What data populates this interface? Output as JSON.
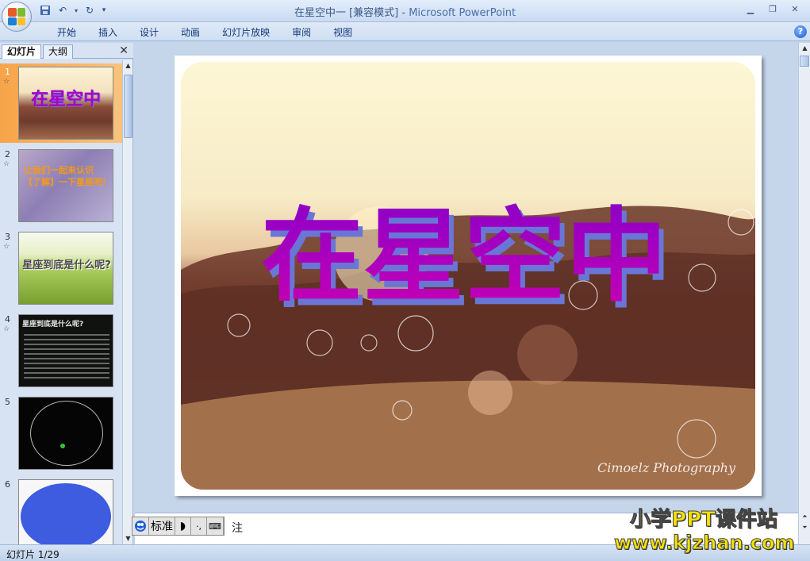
{
  "window": {
    "title": "在星空中一 [兼容模式] - Microsoft PowerPoint",
    "title_doc": "在星空中一 [兼容模式]",
    "title_sep": " - ",
    "title_app": "Microsoft PowerPoint",
    "minimize_icon": "minimize-icon",
    "restore_icon": "restore-icon",
    "close_icon": "close-icon"
  },
  "ribbon": {
    "tabs": [
      "开始",
      "插入",
      "设计",
      "动画",
      "幻灯片放映",
      "审阅",
      "视图"
    ],
    "help_label": "?"
  },
  "left_pane": {
    "tab_slides": "幻灯片",
    "tab_outline": "大纲",
    "close_label": "✕",
    "thumbnails": [
      {
        "num": "1",
        "star": "☆",
        "text": "在星空中"
      },
      {
        "num": "2",
        "star": "☆",
        "text": "让我们一起来认识【了解】一下星座吧!"
      },
      {
        "num": "3",
        "star": "☆",
        "text": "星座到底是什么呢?"
      },
      {
        "num": "4",
        "star": "☆",
        "text": "星座到底是什么呢?"
      },
      {
        "num": "5",
        "star": "☆",
        "text": ""
      },
      {
        "num": "6",
        "star": "",
        "text": ""
      }
    ]
  },
  "slide": {
    "title": "在星空中",
    "photo_credit": "Cimoelz Photography"
  },
  "notes": {
    "text": "注"
  },
  "ime": {
    "mode": "标准"
  },
  "status": {
    "slide_counter": "幻灯片 1/29"
  },
  "watermark": {
    "line1": "小学PPT课件站",
    "line2": "www.kjzhan.com"
  },
  "colors": {
    "title_purple": "#a800c8",
    "selected_thumb": "#f7a449",
    "ribbon_text": "#15397a"
  }
}
